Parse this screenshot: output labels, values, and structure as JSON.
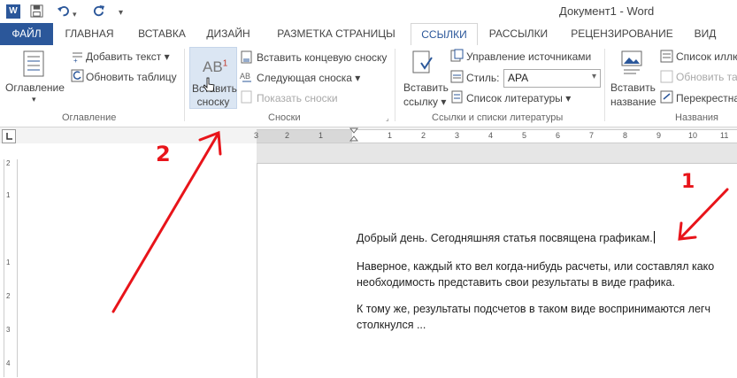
{
  "app": {
    "title": "Документ1 - Word",
    "logo": "W"
  },
  "quick_access": {
    "save_icon": "save-icon",
    "undo_icon": "undo-icon",
    "redo_icon": "redo-icon",
    "customize_icon": "chevron-down-icon"
  },
  "tabs": [
    {
      "label": "ФАЙЛ"
    },
    {
      "label": "ГЛАВНАЯ"
    },
    {
      "label": "ВСТАВКА"
    },
    {
      "label": "ДИЗАЙН"
    },
    {
      "label": "РАЗМЕТКА СТРАНИЦЫ"
    },
    {
      "label": "ССЫЛКИ"
    },
    {
      "label": "РАССЫЛКИ"
    },
    {
      "label": "РЕЦЕНЗИРОВАНИЕ"
    },
    {
      "label": "ВИД"
    }
  ],
  "ribbon": {
    "toc": {
      "button": "Оглавление",
      "add_text": "Добавить текст",
      "update_table": "Обновить таблицу",
      "group": "Оглавление"
    },
    "footnotes": {
      "insert_line1": "Вставить",
      "insert_line2": "сноску",
      "big_icon_text": "AB",
      "big_icon_sup": "1",
      "insert_endnote": "Вставить концевую сноску",
      "next_footnote": "Следующая сноска",
      "show_notes": "Показать сноски",
      "group": "Сноски"
    },
    "citations": {
      "insert_line1": "Вставить",
      "insert_line2": "ссылку",
      "manage_sources": "Управление источниками",
      "style_label": "Стиль:",
      "style_value": "APA",
      "bibliography": "Список литературы",
      "group": "Ссылки и списки литературы"
    },
    "captions": {
      "insert_line1": "Вставить",
      "insert_line2": "название",
      "list_of": "Список иллю",
      "update_table": "Обновить та",
      "cross_ref": "Перекрестна",
      "group": "Названия"
    }
  },
  "ruler": {
    "ticks": [
      "3",
      "2",
      "1",
      "1",
      "2",
      "3",
      "4",
      "5",
      "6",
      "7",
      "8",
      "9",
      "10",
      "11"
    ],
    "vticks": [
      "2",
      "1",
      "1",
      "2",
      "3",
      "4"
    ]
  },
  "document": {
    "p1": "Добрый день. Сегодняшняя статья посвящена графикам.",
    "p2_line1": "Наверное, каждый кто вел когда-нибудь расчеты, или составлял како",
    "p2_line2": "необходимость представить свои результаты в виде графика.",
    "p3_line1": "К тому же, результаты подсчетов в таком виде воспринимаются легч",
    "p3_line2": "столкнулся ..."
  },
  "annotations": {
    "label1": "1",
    "label2": "2",
    "color": "#e8141a"
  },
  "colors": {
    "accent": "#2b579a",
    "annotation": "#e8141a"
  }
}
